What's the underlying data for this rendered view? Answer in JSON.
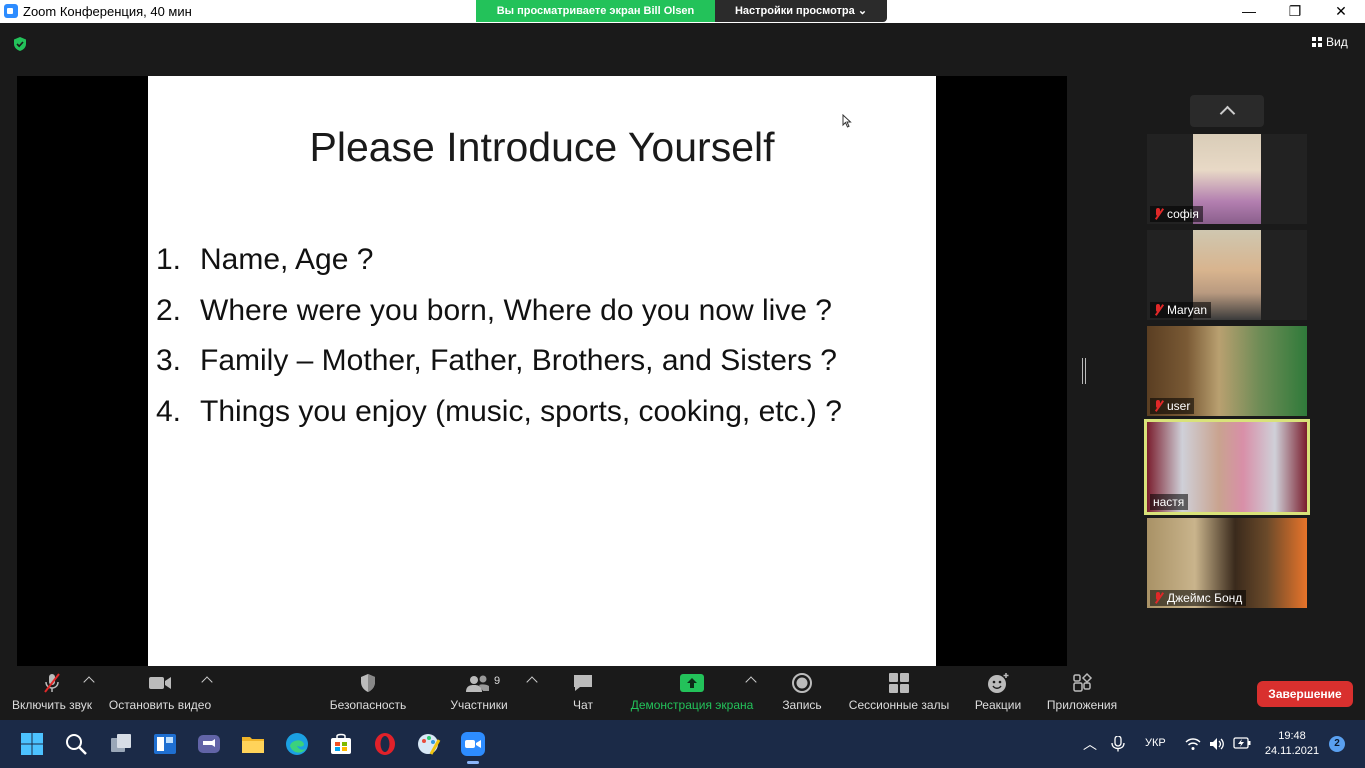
{
  "window": {
    "title": "Zoom Конференция, 40 мин",
    "share_banner": "Вы просматриваете экран Bill Olsen",
    "view_options": "Настройки просмотра",
    "view_button": "Вид"
  },
  "slide": {
    "title": "Please Introduce Yourself",
    "items": [
      {
        "num": "1.",
        "text": "Name, Age ?"
      },
      {
        "num": "2.",
        "text": "Where were you born, Where do you now live  ?"
      },
      {
        "num": "3.",
        "text": "Family – Mother, Father, Brothers, and Sisters ?"
      },
      {
        "num": "4.",
        "text": "Things you enjoy (music, sports, cooking, etc.) ?"
      }
    ]
  },
  "participants": [
    {
      "name": "софія",
      "muted": true
    },
    {
      "name": "Maryan",
      "muted": true
    },
    {
      "name": "user",
      "muted": true
    },
    {
      "name": "настя",
      "muted": false,
      "active_speaker": true
    },
    {
      "name": "Джеймс Бонд",
      "muted": true
    }
  ],
  "toolbar": {
    "audio": "Включить звук",
    "video": "Остановить видео",
    "security": "Безопасность",
    "participants": "Участники",
    "participants_count": "9",
    "chat": "Чат",
    "share": "Демонстрация экрана",
    "record": "Запись",
    "breakout": "Сессионные залы",
    "reactions": "Реакции",
    "apps": "Приложения",
    "end": "Завершение"
  },
  "taskbar": {
    "language": "УКР",
    "time": "19:48",
    "date": "24.11.2021",
    "notifications": "2"
  },
  "colors": {
    "share_green": "#23C25A",
    "end_red": "#d9302e",
    "active_speaker": "#d9e27a",
    "zoom_blue": "#2D8CFF"
  }
}
